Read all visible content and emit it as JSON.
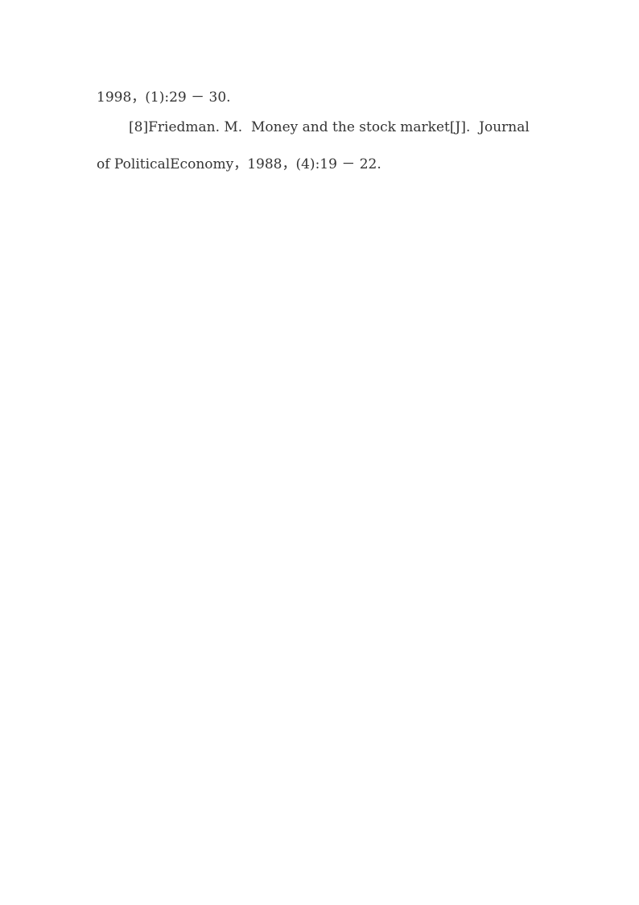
{
  "document": {
    "lines": [
      "1998，(1):29 － 30.",
      "[8]Friedman. M.  Money and the stock market[J].  Journal",
      "of PoliticalEconomy，1988，(4):19 － 22."
    ],
    "references": [
      {
        "continuation": "1998，(1):29 － 30."
      },
      {
        "index": "[8]",
        "author": "Friedman. M.",
        "title": "Money and the stock market",
        "type": "[J]",
        "journal": "Journal of PoliticalEconomy",
        "year": "1988",
        "issue": "(4)",
        "pages": "19 － 22"
      }
    ]
  }
}
